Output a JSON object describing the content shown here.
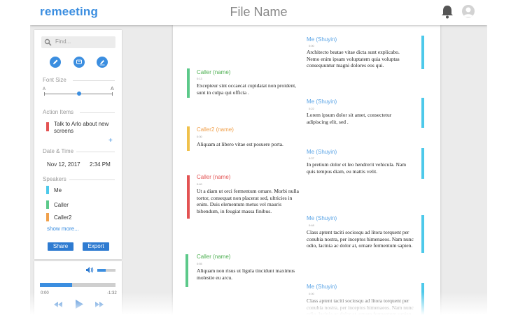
{
  "header": {
    "brand": "remeeting",
    "file_name": "File Name"
  },
  "sidebar": {
    "search_placeholder": "Find...",
    "font_size_label": "Font Size",
    "font_small": "A",
    "font_large": "A",
    "font_size_level": 0.52,
    "action_items_label": "Action Items",
    "action_items": [
      {
        "text": "Talk to Arlo about new screens",
        "color": "#e35353"
      }
    ],
    "date_time_label": "Date & Time",
    "date": "Nov 12, 2017",
    "time": "2:34 PM",
    "speakers_label": "Speakers",
    "speakers": [
      {
        "name": "Me",
        "color": "#4dc9ea"
      },
      {
        "name": "Caller",
        "color": "#5cc98a"
      },
      {
        "name": "Caller2",
        "color": "#f0a04b"
      }
    ],
    "show_more": "show more...",
    "share_label": "Share",
    "export_label": "Export"
  },
  "player": {
    "elapsed": "0:00",
    "remaining": "-1:32",
    "progress": 0.43,
    "volume": 0.45
  },
  "transcript": [
    {
      "speaker": "Me (Shuyin)",
      "time": "0:00",
      "color": "#4dc9ea",
      "name_color": "#5aa4e6",
      "side": "right",
      "text": "Architecto beatae vitae dicta sunt explicabo. Nemo enim ipsam voluptatem quia voluptas consequuntur magni dolores eos qui."
    },
    {
      "speaker": "Caller (name)",
      "time": "0:13",
      "color": "#5cc98a",
      "name_color": "#4caf50",
      "side": "left",
      "text": "Excepteur sint occaecat cupidatat non proident, sunt in culpa qui officia ."
    },
    {
      "speaker": "Me (Shuyin)",
      "time": "0:22",
      "color": "#4dc9ea",
      "name_color": "#5aa4e6",
      "side": "right",
      "text": "Lorem ipsum dolor sit amet, consectetur adipiscing elit, sed ."
    },
    {
      "speaker": "Caller2 (name)",
      "time": "0:30",
      "color": "#f0c14b",
      "name_color": "#f0a04b",
      "side": "left",
      "text": "Aliquam at libero vitae est posuere porta."
    },
    {
      "speaker": "Me (Shuyin)",
      "time": "0:37",
      "color": "#4dc9ea",
      "name_color": "#5aa4e6",
      "side": "right",
      "text": "In pretium dolor et leo hendrerit vehicula. Nam quis tempus diam, eu mattis velit."
    },
    {
      "speaker": "Caller (name)",
      "time": "0:40",
      "color": "#e35353",
      "name_color": "#e35353",
      "side": "left",
      "text": "Ut a diam ut orci fermentum ornare. Morbi nulla tortor, consequat non placerat sed, ultricies in enim. Duis elementum metus vel mauris bibendum, in feugiat massa finibus."
    },
    {
      "speaker": "Me (Shuyin)",
      "time": "0:48",
      "color": "#4dc9ea",
      "name_color": "#5aa4e6",
      "side": "right",
      "text": "Class aptent taciti sociosqu ad litora torquent per conubia nostra, per inceptos himenaeos. Nam nunc odio, lacinia ac dolor at, ornare fermentum sapien."
    },
    {
      "speaker": "Caller (name)",
      "time": "0:55",
      "color": "#5cc98a",
      "name_color": "#4caf50",
      "side": "left",
      "text": "Aliquam non risus ut ligula tincidunt maximus molestie eu arcu."
    },
    {
      "speaker": "Me (Shuyin)",
      "time": "0:00",
      "color": "#4dc9ea",
      "name_color": "#5aa4e6",
      "side": "right",
      "text": "Class aptent taciti sociosqu ad litora torquent per conubia nostra, per inceptos himenaeos. Nam nunc odio, lacinia ac dolor at, ornare fermentum sapien."
    }
  ]
}
